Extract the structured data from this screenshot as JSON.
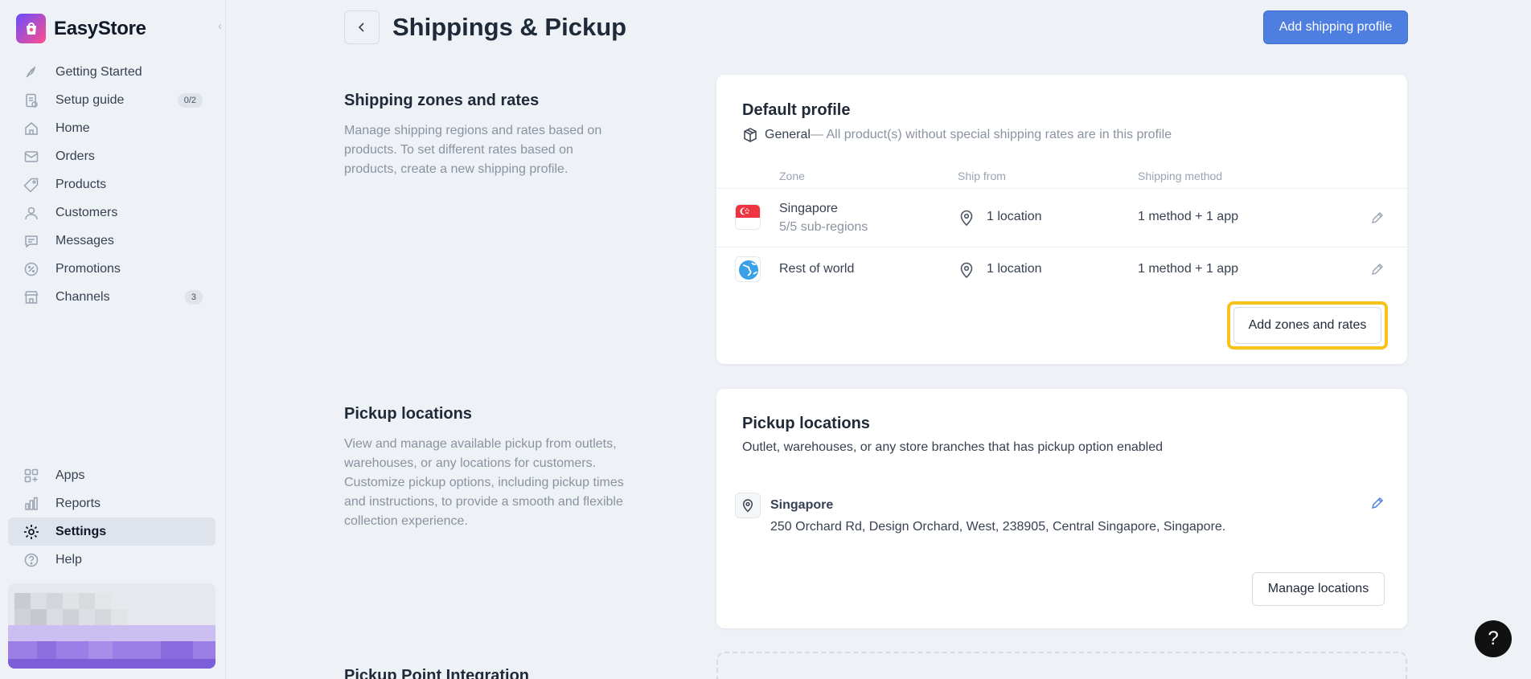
{
  "brand": {
    "name": "EasyStore"
  },
  "nav": {
    "items": [
      {
        "label": "Getting Started",
        "icon": "rocket-icon"
      },
      {
        "label": "Setup guide",
        "icon": "checklist-icon",
        "badge": "0/2"
      },
      {
        "label": "Home",
        "icon": "home-icon"
      },
      {
        "label": "Orders",
        "icon": "inbox-icon"
      },
      {
        "label": "Products",
        "icon": "tag-icon"
      },
      {
        "label": "Customers",
        "icon": "user-icon"
      },
      {
        "label": "Messages",
        "icon": "chat-icon"
      },
      {
        "label": "Promotions",
        "icon": "discount-icon"
      },
      {
        "label": "Channels",
        "icon": "store-icon",
        "badge": "3"
      }
    ],
    "bottom": [
      {
        "label": "Apps",
        "icon": "apps-icon"
      },
      {
        "label": "Reports",
        "icon": "bar-chart-icon"
      },
      {
        "label": "Settings",
        "icon": "gear-icon",
        "active": true
      },
      {
        "label": "Help",
        "icon": "help-icon"
      }
    ]
  },
  "header": {
    "title": "Shippings & Pickup",
    "add_profile_label": "Add shipping profile"
  },
  "shipping_section": {
    "title": "Shipping zones and rates",
    "description": "Manage shipping regions and rates based on products. To set different rates based on products, create a new shipping profile."
  },
  "default_profile": {
    "title": "Default profile",
    "general_label": "General",
    "general_desc": " — All product(s) without special shipping rates are in this profile",
    "columns": {
      "zone": "Zone",
      "ship_from": "Ship from",
      "method": "Shipping method"
    },
    "zones": [
      {
        "name": "Singapore",
        "sub": "5/5 sub-regions",
        "ship_from": "1 location",
        "method": "1 method + 1 app",
        "flag": "singapore-flag-icon"
      },
      {
        "name": "Rest of world",
        "sub": "",
        "ship_from": "1 location",
        "method": "1 method + 1 app",
        "flag": "globe-icon"
      }
    ],
    "add_zones_label": "Add zones and rates"
  },
  "pickup_section": {
    "title": "Pickup locations",
    "description": "View and manage available pickup from outlets, warehouses, or any locations for customers. Customize pickup options, including pickup times and instructions, to provide a smooth and flexible collection experience."
  },
  "pickup_card": {
    "title": "Pickup locations",
    "subtitle": "Outlet, warehouses, or any store branches that has pickup option enabled",
    "location_name": "Singapore",
    "location_address": "250 Orchard Rd, Design Orchard, West, 238905, Central Singapore, Singapore.",
    "manage_label": "Manage locations"
  },
  "pickup_point": {
    "title": "Pickup Point Integration"
  },
  "help": {
    "label": "?"
  },
  "colors": {
    "accent": "#4e7fe0",
    "highlight": "#f9c21a"
  }
}
